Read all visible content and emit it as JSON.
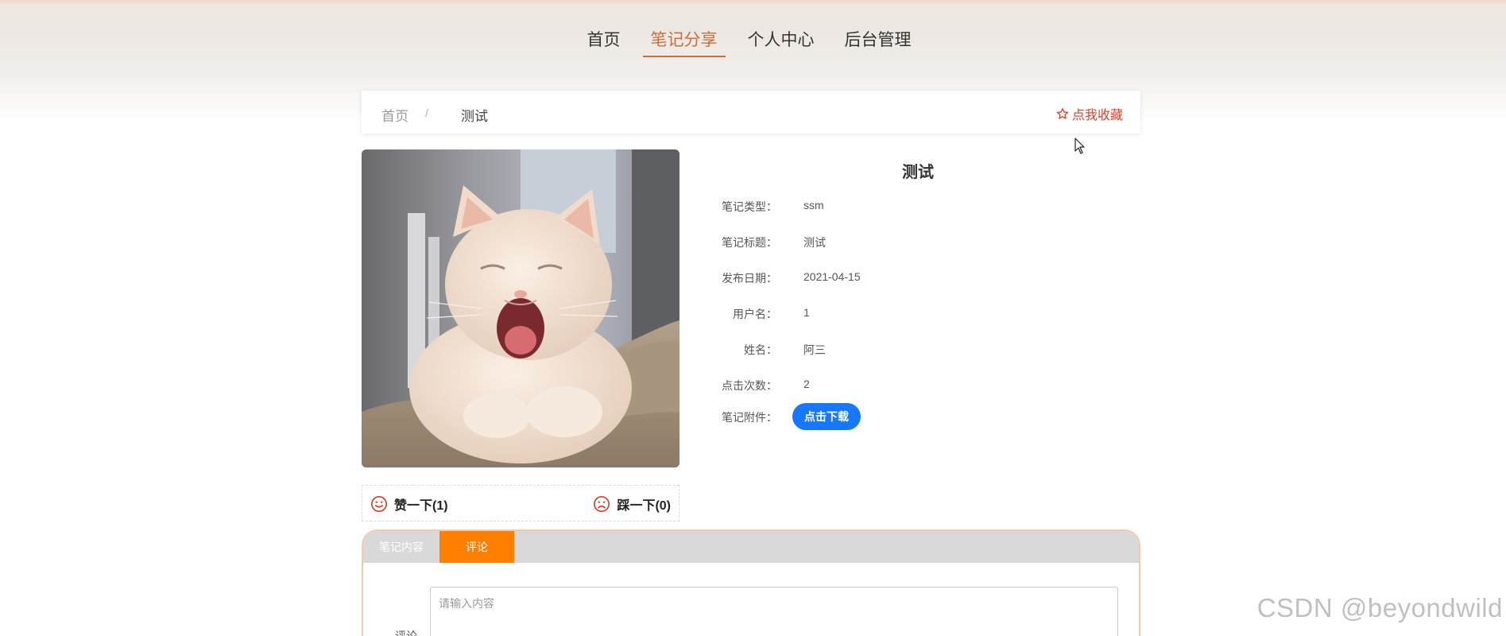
{
  "nav": {
    "items": [
      {
        "label": "首页",
        "active": false
      },
      {
        "label": "笔记分享",
        "active": true
      },
      {
        "label": "个人中心",
        "active": false
      },
      {
        "label": "后台管理",
        "active": false
      }
    ]
  },
  "breadcrumb": {
    "home": "首页",
    "separator": "/",
    "current": "测试"
  },
  "favorite": {
    "label": "点我收藏",
    "icon": "star-outline-icon"
  },
  "photo": {
    "icon": "cat-photo"
  },
  "votes": {
    "up_label": "赞一下(1)",
    "down_label": "踩一下(0)",
    "up_icon": "smile-icon",
    "down_icon": "frown-icon"
  },
  "detail": {
    "title": "测试",
    "fields": [
      {
        "label": "笔记类型：",
        "value": "ssm"
      },
      {
        "label": "笔记标题：",
        "value": "测试"
      },
      {
        "label": "发布日期：",
        "value": "2021-04-15"
      },
      {
        "label": "用户名：",
        "value": "1"
      },
      {
        "label": "姓名：",
        "value": "阿三"
      },
      {
        "label": "点击次数：",
        "value": "2"
      }
    ],
    "attachment_label": "笔记附件：",
    "download_label": "点击下载"
  },
  "tabs": {
    "items": [
      {
        "label": "笔记内容",
        "active": false
      },
      {
        "label": "评论",
        "active": true
      }
    ]
  },
  "comment": {
    "label": "评论",
    "placeholder": "请输入内容",
    "value": ""
  },
  "watermark": "CSDN @beyondwild",
  "colors": {
    "accent_orange": "#ff7f00",
    "nav_active": "#c8703a",
    "download_blue": "#1677ff",
    "favorite_red": "#d9412b",
    "vote_red": "#d9412b"
  }
}
